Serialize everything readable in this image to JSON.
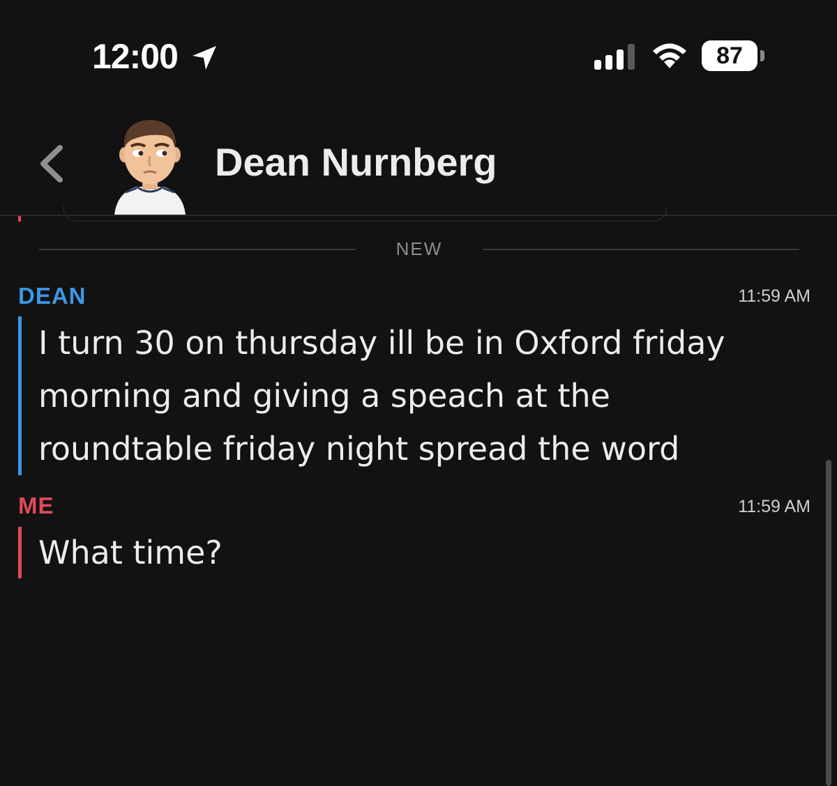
{
  "status_bar": {
    "time": "12:00",
    "battery_level": "87",
    "icons": [
      "location-arrow-icon",
      "cellular-signal-icon",
      "wifi-icon",
      "battery-icon"
    ]
  },
  "header": {
    "contact_name": "Dean Nurnberg",
    "back_icon": "chevron-left-icon",
    "avatar": "bitmoji-avatar"
  },
  "chat": {
    "divider_label": "NEW",
    "messages": [
      {
        "sender": "DEAN",
        "time": "11:59 AM",
        "text": "I turn 30 on thursday ill be in Oxford friday morning and giving a speach at the roundtable friday night spread the word",
        "accent_color": "#3d97e5"
      },
      {
        "sender": "ME",
        "time": "11:59 AM",
        "text": "What time?",
        "accent_color": "#e04a5a"
      }
    ]
  },
  "colors": {
    "background": "#121212",
    "dean_blue": "#3d97e5",
    "me_red": "#e04a5a",
    "text": "#ececec"
  }
}
